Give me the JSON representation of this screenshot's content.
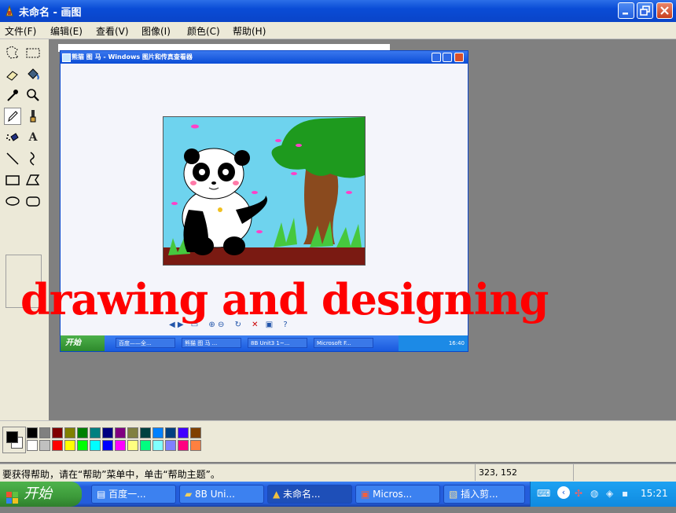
{
  "window": {
    "title": "未命名 - 画图"
  },
  "menu": [
    "文件(F)",
    "编辑(E)",
    "查看(V)",
    "图像(I)",
    "颜色(C)",
    "帮助(H)"
  ],
  "inner_window": {
    "title": "熊猫 图 马 - Windows 图片和传真查看器",
    "taskbar_start": "开始",
    "tasks": [
      "百度——全...",
      "熊猫 图 马 ...",
      "8B Unit3 1~...",
      "Microsoft F..."
    ],
    "clock": "16:40"
  },
  "overlay_text": "drawing and designing",
  "palette": {
    "row1": [
      "#000000",
      "#808080",
      "#800000",
      "#808000",
      "#008000",
      "#008080",
      "#000080",
      "#800080",
      "#808040",
      "#004040",
      "#0080ff",
      "#004080",
      "#4000ff",
      "#804000"
    ],
    "row2": [
      "#ffffff",
      "#c0c0c0",
      "#ff0000",
      "#ffff00",
      "#00ff00",
      "#00ffff",
      "#0000ff",
      "#ff00ff",
      "#ffff80",
      "#00ff80",
      "#80ffff",
      "#8080ff",
      "#ff0080",
      "#ff8040"
    ],
    "foreground": "#000000",
    "background": "#ffffff"
  },
  "status": {
    "help_text": "要获得帮助，请在“帮助”菜单中，单击“帮助主题”。",
    "coords": "323, 152"
  },
  "taskbar": {
    "start_label": "开始",
    "tasks": [
      "百度一...",
      "8B Uni...",
      "未命名...",
      "Micros...",
      "插入剪..."
    ],
    "clock": "15:21"
  }
}
